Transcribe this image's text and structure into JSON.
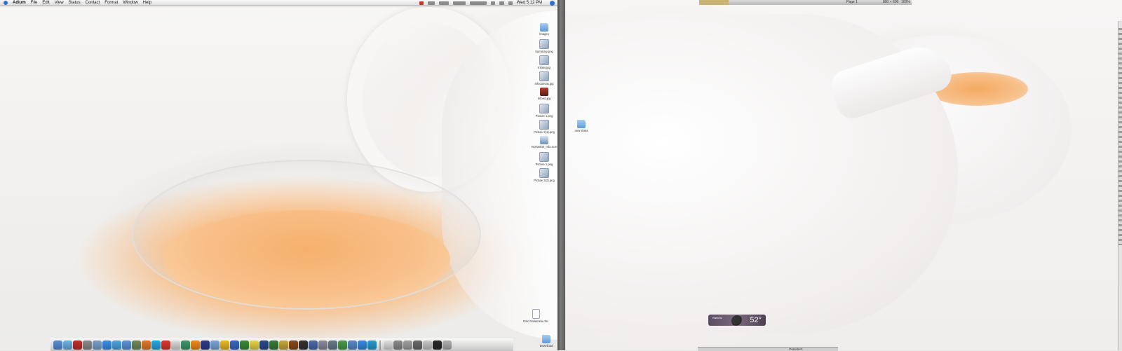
{
  "menubar": {
    "app_name": "Adium",
    "items": [
      "File",
      "Edit",
      "View",
      "Status",
      "Contact",
      "Format",
      "Window",
      "Help"
    ],
    "clock": "Wed 5:12 PM"
  },
  "desktop_left": {
    "icons": [
      {
        "label": "Images",
        "kind": "folder"
      },
      {
        "label": "Summary.png",
        "kind": "image"
      },
      {
        "label": "Infoss.jpg",
        "kind": "image"
      },
      {
        "label": "Infocanvas.jpg",
        "kind": "image"
      },
      {
        "label": "Infoed.jpg",
        "kind": "photo"
      },
      {
        "label": "Picture 1.png",
        "kind": "image"
      },
      {
        "label": "Picture 2(1).png",
        "kind": "image"
      },
      {
        "label": "InDTasket_Info.scrn",
        "kind": "sheet"
      },
      {
        "label": "Picture 1.png",
        "kind": "image"
      },
      {
        "label": "Picture 2(2).png",
        "kind": "image"
      }
    ],
    "bottom_icons": [
      {
        "label": "Gold Soilemelu.doc",
        "kind": "doc"
      },
      {
        "label": "Download",
        "kind": "folder"
      }
    ]
  },
  "desktop_right": {
    "icons": [
      {
        "label": "new shots",
        "kind": "folder"
      }
    ]
  },
  "weather_widget": {
    "city": "Rancho",
    "temperature": "52°"
  },
  "colors": {
    "menubar": "#dcdcdc",
    "tea": "#f6b06c",
    "seam": "#5a5a5a",
    "weather_bg": "#6a5b70",
    "accent": "#2a6ed8"
  },
  "dock": {
    "apps": [
      {
        "name": "finder-icon",
        "color": "#5b8fd6"
      },
      {
        "name": "adium-icon",
        "color": "#6fb2e0"
      },
      {
        "name": "opera-icon",
        "color": "#c0302a"
      },
      {
        "name": "system-prefs-icon",
        "color": "#8a8a8a"
      },
      {
        "name": "mail-icon",
        "color": "#7aa0cc"
      },
      {
        "name": "safari-icon",
        "color": "#3a8ee6"
      },
      {
        "name": "ichat-icon",
        "color": "#4ea3e0"
      },
      {
        "name": "itunes-icon",
        "color": "#5c93d8"
      },
      {
        "name": "iphoto-icon",
        "color": "#6f8a5a"
      },
      {
        "name": "firefox-icon",
        "color": "#e07a2a"
      },
      {
        "name": "skype-icon",
        "color": "#2aa6e0"
      },
      {
        "name": "calendar-icon",
        "color": "#d83a2e"
      },
      {
        "name": "textedit-icon",
        "color": "#dcdcdc"
      },
      {
        "name": "itunes-app-icon",
        "color": "#3a9a6a"
      },
      {
        "name": "vlc-icon",
        "color": "#f08a1a"
      },
      {
        "name": "adobe-icon",
        "color": "#2e3c8c"
      },
      {
        "name": "folder-app-icon",
        "color": "#7aa5d8"
      },
      {
        "name": "transmit-icon",
        "color": "#e8b82a"
      },
      {
        "name": "word-icon",
        "color": "#3a68c0"
      },
      {
        "name": "excel-icon",
        "color": "#3a8a3a"
      },
      {
        "name": "stickies-icon",
        "color": "#e8d34a"
      },
      {
        "name": "photoshop-icon",
        "color": "#2a4a8c"
      },
      {
        "name": "dreamweaver-icon",
        "color": "#3a7a3a"
      },
      {
        "name": "fireworks-icon",
        "color": "#c8a83a"
      },
      {
        "name": "bridge-icon",
        "color": "#8a4a1a"
      },
      {
        "name": "terminal-icon",
        "color": "#333333"
      },
      {
        "name": "network-icon",
        "color": "#4a6aa8"
      },
      {
        "name": "utility-icon",
        "color": "#8a8a9a"
      },
      {
        "name": "pref-icon",
        "color": "#6a7a8a"
      },
      {
        "name": "coda-icon",
        "color": "#4a9a4a"
      },
      {
        "name": "script-icon",
        "color": "#5a8ac8"
      },
      {
        "name": "chrome-icon",
        "color": "#3a88e0"
      },
      {
        "name": "ftp-icon",
        "color": "#2a9ad0"
      }
    ],
    "docs": [
      {
        "name": "doc-stack-icon",
        "color": "#e0e0e0"
      },
      {
        "name": "window-thumb-icon",
        "color": "#8a8a8a"
      },
      {
        "name": "window-thumb-icon",
        "color": "#a0a0a0"
      },
      {
        "name": "window-thumb-icon",
        "color": "#6a6a6a"
      },
      {
        "name": "window-thumb-icon",
        "color": "#c8c8c8"
      },
      {
        "name": "window-thumb-icon",
        "color": "#2a2a2a"
      },
      {
        "name": "trash-icon",
        "color": "#b0b0b0"
      }
    ]
  },
  "right_bar": {
    "title": "Outsider3",
    "page_info": "Page 1",
    "size_info": "800 × 600",
    "zoom": "100%"
  }
}
